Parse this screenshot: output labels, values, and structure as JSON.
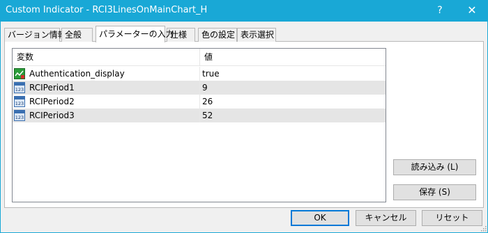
{
  "window": {
    "title": "Custom Indicator - RCI3LinesOnMainChart_H",
    "help_glyph": "?",
    "close_glyph": "✕"
  },
  "tabs": [
    {
      "label": "バージョン情報",
      "active": false
    },
    {
      "label": "全般",
      "active": false
    },
    {
      "label": "パラメーターの入力",
      "active": true
    },
    {
      "label": "仕様",
      "active": false
    },
    {
      "label": "色の設定",
      "active": false
    },
    {
      "label": "表示選択",
      "active": false
    }
  ],
  "grid": {
    "columns": [
      "変数",
      "値"
    ],
    "rows": [
      {
        "icon": "boolean-param-icon",
        "name": "Authentication_display",
        "value": "true",
        "shaded": false
      },
      {
        "icon": "integer-param-icon",
        "name": "RCIPeriod1",
        "value": "9",
        "shaded": true
      },
      {
        "icon": "integer-param-icon",
        "name": "RCIPeriod2",
        "value": "26",
        "shaded": false
      },
      {
        "icon": "integer-param-icon",
        "name": "RCIPeriod3",
        "value": "52",
        "shaded": true
      }
    ]
  },
  "side_buttons": {
    "load": "読み込み (L)",
    "save": "保存 (S)"
  },
  "footer_buttons": {
    "ok": "OK",
    "cancel": "キャンセル",
    "reset": "リセット"
  },
  "colors": {
    "titlebar": "#19a8d6",
    "selected_row": "#e5e5e5",
    "default_button_border": "#0078d7"
  }
}
